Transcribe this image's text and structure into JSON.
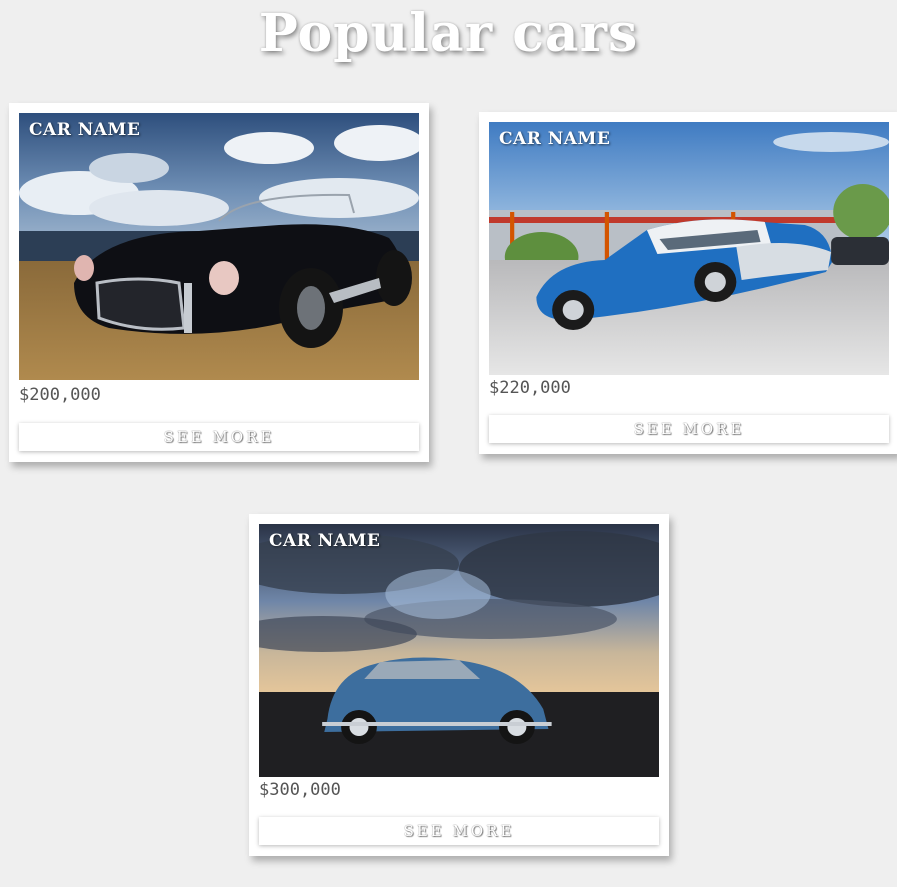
{
  "page": {
    "title": "Popular cars"
  },
  "cars": [
    {
      "name": "CAR NAME",
      "price": "$200,000",
      "button": "SEE MORE",
      "photo": "black-roadster-on-beach-photo"
    },
    {
      "name": "CAR NAME",
      "price": "$220,000",
      "button": "SEE MORE",
      "photo": "blue-vintage-sedan-photo"
    },
    {
      "name": "CAR NAME",
      "price": "$300,000",
      "button": "SEE MORE",
      "photo": "blue-beetle-at-dusk-photo"
    }
  ],
  "colors": {
    "background": "#efefef",
    "card": "#ffffff",
    "price_text": "#555555"
  }
}
